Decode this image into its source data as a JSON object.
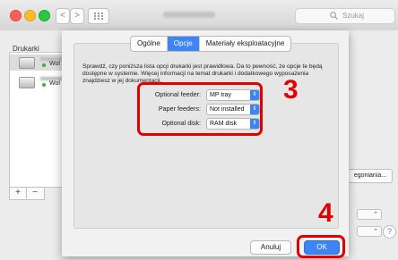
{
  "window": {
    "search_placeholder": "Szukaj",
    "nav_back": "<",
    "nav_forward": ">",
    "grid_icon": "grid-icon"
  },
  "printers": {
    "label": "Drukarki",
    "items": [
      {
        "name": "Wol",
        "status": "online"
      },
      {
        "name": "Wol",
        "status": "online"
      }
    ],
    "add": "+",
    "remove": "−"
  },
  "background_controls": {
    "right_button": "egoniania..."
  },
  "tabs": [
    {
      "label": "Ogólne",
      "active": false
    },
    {
      "label": "Opcje",
      "active": true
    },
    {
      "label": "Materiały eksploatacyjne",
      "active": false
    }
  ],
  "description": "Sprawdź, czy poniższa lista opcji drukarki jest prawidłowa. Da to pewność, że opcje te będą dostępne w systemie. Więcej informacji na temat drukarki i dodatkowego wyposażenia znajdziesz w jej dokumentacji.",
  "options": [
    {
      "label": "Optional feeder:",
      "value": "MP tray"
    },
    {
      "label": "Paper feeders:",
      "value": "Not installed"
    },
    {
      "label": "Optional disk:",
      "value": "RAM disk"
    }
  ],
  "buttons": {
    "cancel": "Anuluj",
    "ok": "OK"
  },
  "callouts": {
    "step3": "3",
    "step4": "4",
    "color": "#e50000"
  },
  "colors": {
    "accent": "#3d84f5"
  }
}
